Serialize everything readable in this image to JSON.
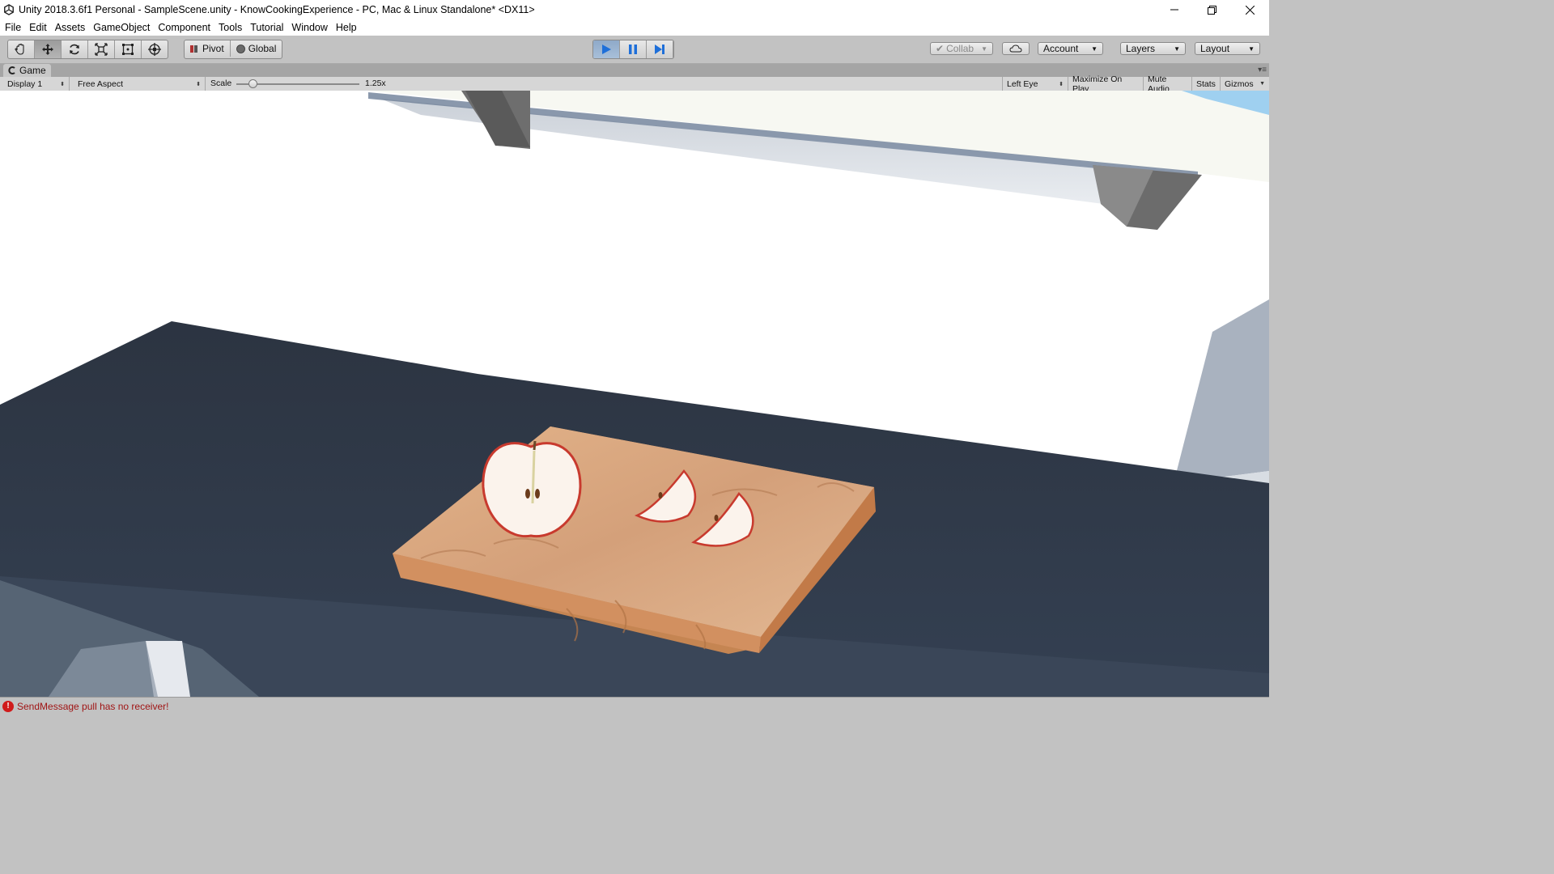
{
  "window": {
    "title": "Unity 2018.3.6f1 Personal - SampleScene.unity - KnowCookingExperience - PC, Mac & Linux Standalone* <DX11>",
    "controls": [
      "minimize-icon",
      "restore-icon",
      "close-icon"
    ]
  },
  "menu": [
    "File",
    "Edit",
    "Assets",
    "GameObject",
    "Component",
    "Tools",
    "Tutorial",
    "Window",
    "Help"
  ],
  "toolbar": {
    "transform_tools": [
      "hand-tool",
      "move-tool",
      "rotate-tool",
      "scale-tool",
      "rect-tool",
      "transform-tool"
    ],
    "active_tool": "move-tool",
    "pivot_label": "Pivot",
    "global_label": "Global",
    "playback": {
      "playing": true,
      "paused": false
    },
    "collab_label": "Collab",
    "account_label": "Account",
    "layers_label": "Layers",
    "layout_label": "Layout"
  },
  "game_view": {
    "tab_label": "Game",
    "display": "Display 1",
    "aspect": "Free Aspect",
    "scale_label": "Scale",
    "scale_value": "1.25x",
    "scale_fraction": 0.12,
    "eye": "Left Eye",
    "maximize_on_play": "Maximize On Play",
    "mute_audio": "Mute Audio",
    "stats": "Stats",
    "gizmos": "Gizmos"
  },
  "colors": {
    "editor_bg": "#c2c2c2",
    "play_active": "#1e6fd9",
    "counter": "#2f3a48",
    "board": "#d9a070",
    "error": "#d01b1b"
  },
  "status": {
    "icon": "error-icon",
    "message": "SendMessage pull has no receiver!"
  }
}
